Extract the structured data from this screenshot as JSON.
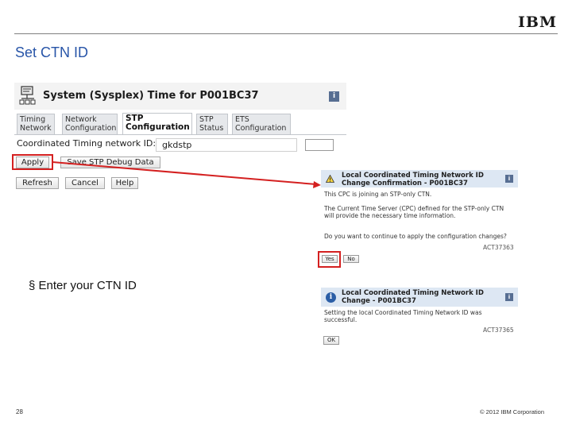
{
  "slide": {
    "logo": "IBM",
    "title": "Set CTN ID",
    "bullet": "§ Enter your CTN ID",
    "page_number": "28",
    "copyright": "© 2012 IBM Corporation"
  },
  "main_window": {
    "title": "System (Sysplex) Time for P001BC37",
    "help": "i",
    "tabs": [
      {
        "line1": "Timing",
        "line2": "Network",
        "active": false
      },
      {
        "line1": "Network",
        "line2": "Configuration",
        "active": false
      },
      {
        "line1": "STP",
        "line2": "Configuration",
        "active": true
      },
      {
        "line1": "STP",
        "line2": "Status",
        "active": false
      },
      {
        "line1": "ETS",
        "line2": "Configuration",
        "active": false
      }
    ],
    "ctn_label": "Coordinated Timing network ID:",
    "ctn_value": "gkdstp",
    "buttons": {
      "apply": "Apply",
      "save_debug": "Save STP Debug Data",
      "refresh": "Refresh",
      "cancel": "Cancel",
      "help": "Help"
    }
  },
  "confirm_dialog": {
    "title": "Local Coordinated Timing Network ID Change Confirmation - P001BC37",
    "help": "i",
    "line1": "This CPC is joining an STP-only CTN.",
    "line2": "The Current Time Server (CPC) defined for the STP-only CTN will provide the necessary time information.",
    "question": "Do you want to continue to apply the configuration changes?",
    "code": "ACT37363",
    "yes": "Yes",
    "no": "No"
  },
  "success_dialog": {
    "title": "Local Coordinated Timing Network ID Change - P001BC37",
    "help": "i",
    "message": "Setting the local Coordinated Timing Network ID was successful.",
    "code": "ACT37365",
    "ok": "OK"
  },
  "colors": {
    "title_blue": "#2855a8",
    "highlight_red": "#d42020",
    "dialog_header": "#dde7f3"
  }
}
